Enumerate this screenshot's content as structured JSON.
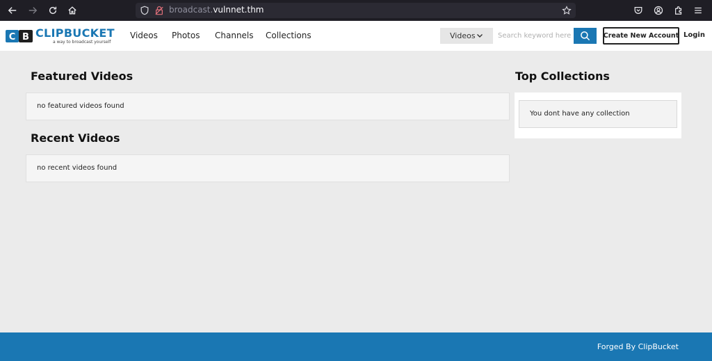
{
  "browser": {
    "url_prefix": "broadcast.",
    "url_host": "vulnnet.thm"
  },
  "header": {
    "logo_text": "CLIPBUCKET",
    "logo_tagline": "a way to broadcast yourself",
    "nav": [
      "Videos",
      "Photos",
      "Channels",
      "Collections"
    ],
    "search_type": "Videos",
    "search_placeholder": "Search keyword here",
    "create_account_label": "Create New Account",
    "login_label": "Login"
  },
  "featured": {
    "title": "Featured Videos",
    "empty_text": "no featured videos found"
  },
  "recent": {
    "title": "Recent Videos",
    "empty_text": "no recent videos found"
  },
  "collections": {
    "title": "Top Collections",
    "empty_text": "You dont have any collection"
  },
  "footer": {
    "text": "Forged By ClipBucket"
  },
  "colors": {
    "brand": "#1a77b3",
    "browser_bg": "#1f1e25",
    "page_bg": "#ebebeb"
  }
}
